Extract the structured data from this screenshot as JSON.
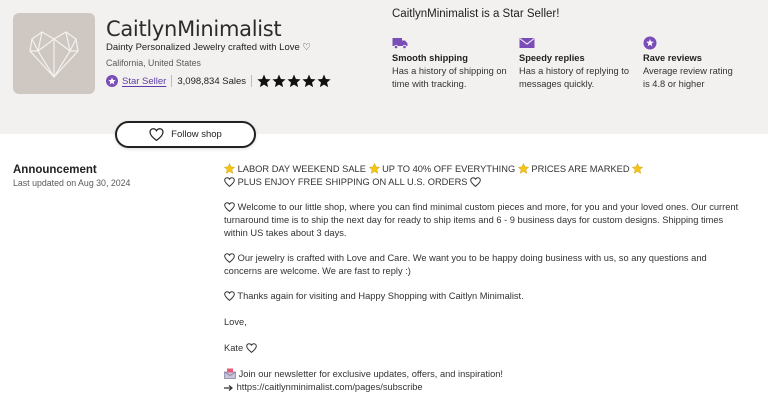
{
  "shop": {
    "name": "CaitlynMinimalist",
    "tagline": "Dainty Personalized Jewelry crafted with Love ♡",
    "location": "California, United States",
    "star_seller_label": "Star Seller",
    "sales": "3,098,834 Sales",
    "rating_stars": 5,
    "follow_label": "Follow shop"
  },
  "star_seller": {
    "title": "CaitlynMinimalist is a Star Seller!",
    "perks": [
      {
        "icon": "truck-icon",
        "title": "Smooth shipping",
        "desc": "Has a history of shipping on time with tracking."
      },
      {
        "icon": "envelope-icon",
        "title": "Speedy replies",
        "desc": "Has a history of replying to messages quickly."
      },
      {
        "icon": "star-badge-icon",
        "title": "Rave reviews",
        "desc": "Average review rating is 4.8 or higher"
      }
    ]
  },
  "announcement": {
    "title": "Announcement",
    "updated": "Last updated on Aug 30, 2024",
    "sale_line_1": "LABOR DAY WEEKEND SALE",
    "sale_line_2": "UP TO 40% OFF EVERYTHING",
    "sale_line_3": "PRICES ARE MARKED",
    "shipping_line": "PLUS ENJOY FREE SHIPPING ON ALL U.S. ORDERS",
    "welcome": "Welcome to our little shop, where you can find minimal custom pieces and more, for you and your loved ones. Our current turnaround time is to ship the next day for ready to ship items and 6 - 9 business days for custom designs. Shipping times within US takes about 3 days.",
    "crafted": "Our jewelry is crafted with Love and Care. We want you to be happy doing business with us, so any questions and concerns are welcome. We are fast to reply :)",
    "thanks": "Thanks again for visiting and Happy Shopping with Caitlyn Minimalist.",
    "love": "Love,",
    "signature": "Kate",
    "newsletter": "Join our newsletter for exclusive updates, offers, and inspiration!",
    "link": "https://caitlynminimalist.com/pages/subscribe"
  },
  "colors": {
    "header_bg": "#f3f1ef",
    "accent_purple": "#7a4db8",
    "star_gold": "#f5c518"
  }
}
